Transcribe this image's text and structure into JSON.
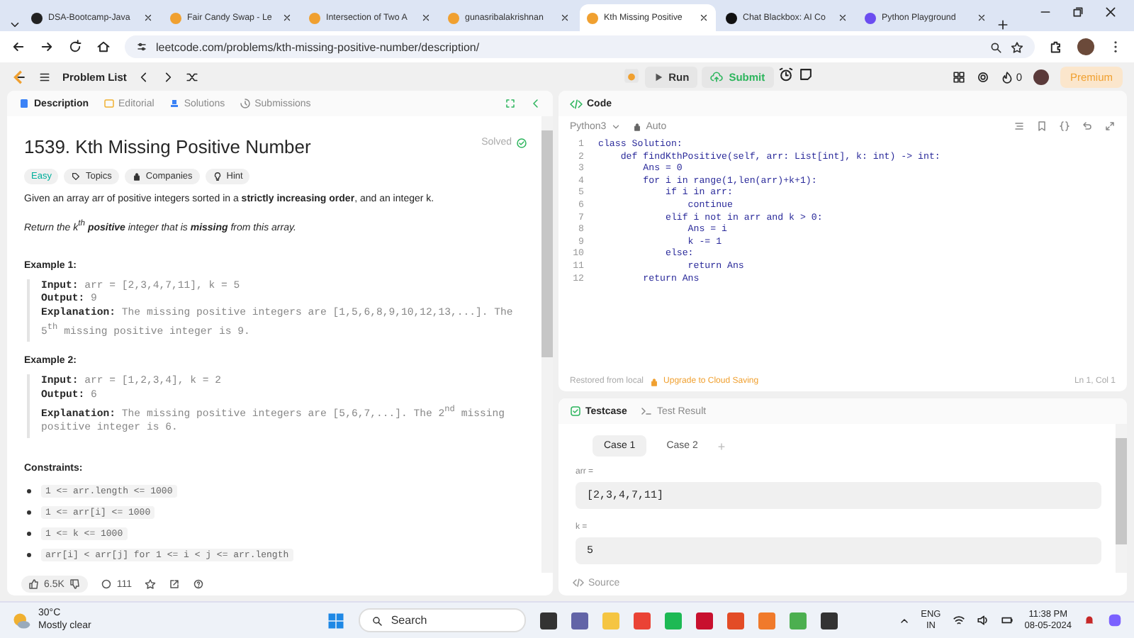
{
  "browser": {
    "tabs": [
      {
        "title": "DSA-Bootcamp-Java",
        "selected": false
      },
      {
        "title": "Fair Candy Swap - Le",
        "selected": false
      },
      {
        "title": "Intersection of Two A",
        "selected": false
      },
      {
        "title": "gunasribalakrishnan",
        "selected": false
      },
      {
        "title": "Kth Missing Positive",
        "selected": true
      },
      {
        "title": "Chat Blackbox: AI Co",
        "selected": false
      },
      {
        "title": "Python Playground",
        "selected": false
      }
    ],
    "url": "leetcode.com/problems/kth-missing-positive-number/description/"
  },
  "toolbar": {
    "problem_list": "Problem List",
    "run": "Run",
    "submit": "Submit",
    "streak": "0",
    "premium": "Premium"
  },
  "description_panel": {
    "tabs": [
      {
        "label": "Description",
        "selected": true
      },
      {
        "label": "Editorial",
        "selected": false
      },
      {
        "label": "Solutions",
        "selected": false
      },
      {
        "label": "Submissions",
        "selected": false
      }
    ],
    "title": "1539. Kth Missing Positive Number",
    "status": "Solved",
    "tags": [
      {
        "label": "Easy",
        "kind": "difficulty"
      },
      {
        "label": "Topics",
        "kind": "topics"
      },
      {
        "label": "Companies",
        "kind": "companies"
      },
      {
        "label": "Hint",
        "kind": "hint"
      }
    ],
    "paragraphs": [
      {
        "text": "Given an array arr of positive integers sorted in a **strictly increasing order**, and an integer k.",
        "italic": false
      },
      {
        "text": "Return the k$^{th}$ **positive** integer that is **missing** from this array.",
        "italic": true
      }
    ],
    "examples": [
      {
        "heading": "Example 1:",
        "lines": [
          "**Input:** arr = [2,3,4,7,11], k = 5",
          "**Output:** 9",
          "**Explanation:** The missing positive integers are [1,5,6,8,9,10,12,13,...]. The 5$^{th}$ missing positive integer is 9."
        ]
      },
      {
        "heading": "Example 2:",
        "lines": [
          "**Input:** arr = [1,2,3,4], k = 2",
          "**Output:** 6",
          "**Explanation:** The missing positive integers are [5,6,7,...]. The 2$^{nd}$ missing positive integer is 6."
        ]
      }
    ],
    "constraints_heading": "Constraints:",
    "constraints": [
      "1 <= arr.length <= 1000",
      "1 <= arr[i] <= 1000",
      "1 <= k <= 1000",
      "arr[i] < arr[j] for 1 <= i < j <= arr.length"
    ],
    "likes": "6.5K",
    "comments": "111"
  },
  "code_panel": {
    "title": "Code",
    "language": "Python3",
    "mode": "Auto",
    "lines": [
      {
        "number": "1",
        "text": "class Solution:"
      },
      {
        "number": "2",
        "text": "    def findKthPositive(self, arr: List[int], k: int) -> int:"
      },
      {
        "number": "3",
        "text": "        Ans = 0"
      },
      {
        "number": "4",
        "text": "        for i in range(1,len(arr)+k+1):"
      },
      {
        "number": "5",
        "text": "            if i in arr:"
      },
      {
        "number": "6",
        "text": "                continue"
      },
      {
        "number": "7",
        "text": "            elif i not in arr and k > 0:"
      },
      {
        "number": "8",
        "text": "                Ans = i"
      },
      {
        "number": "9",
        "text": "                k -= 1"
      },
      {
        "number": "10",
        "text": "            else:"
      },
      {
        "number": "11",
        "text": "                return Ans"
      },
      {
        "number": "12",
        "text": "        return Ans"
      }
    ],
    "status": "Restored from local",
    "upgrade": "Upgrade to Cloud Saving",
    "cursor": "Ln 1, Col 1"
  },
  "testcase_panel": {
    "tabs": [
      {
        "label": "Testcase",
        "selected": true
      },
      {
        "label": "Test Result",
        "selected": false
      }
    ],
    "cases": [
      {
        "label": "Case 1",
        "selected": true
      },
      {
        "label": "Case 2",
        "selected": false
      }
    ],
    "add": "+",
    "inputs": [
      {
        "label": "arr =",
        "value": "[2,3,4,7,11]"
      },
      {
        "label": "k =",
        "value": "5"
      }
    ],
    "source": "Source"
  },
  "taskbar": {
    "temperature": "30°C",
    "weather": "Mostly clear",
    "search_placeholder": "Search",
    "language": "ENG",
    "region": "IN",
    "time": "11:38 PM",
    "date": "08-05-2024"
  }
}
